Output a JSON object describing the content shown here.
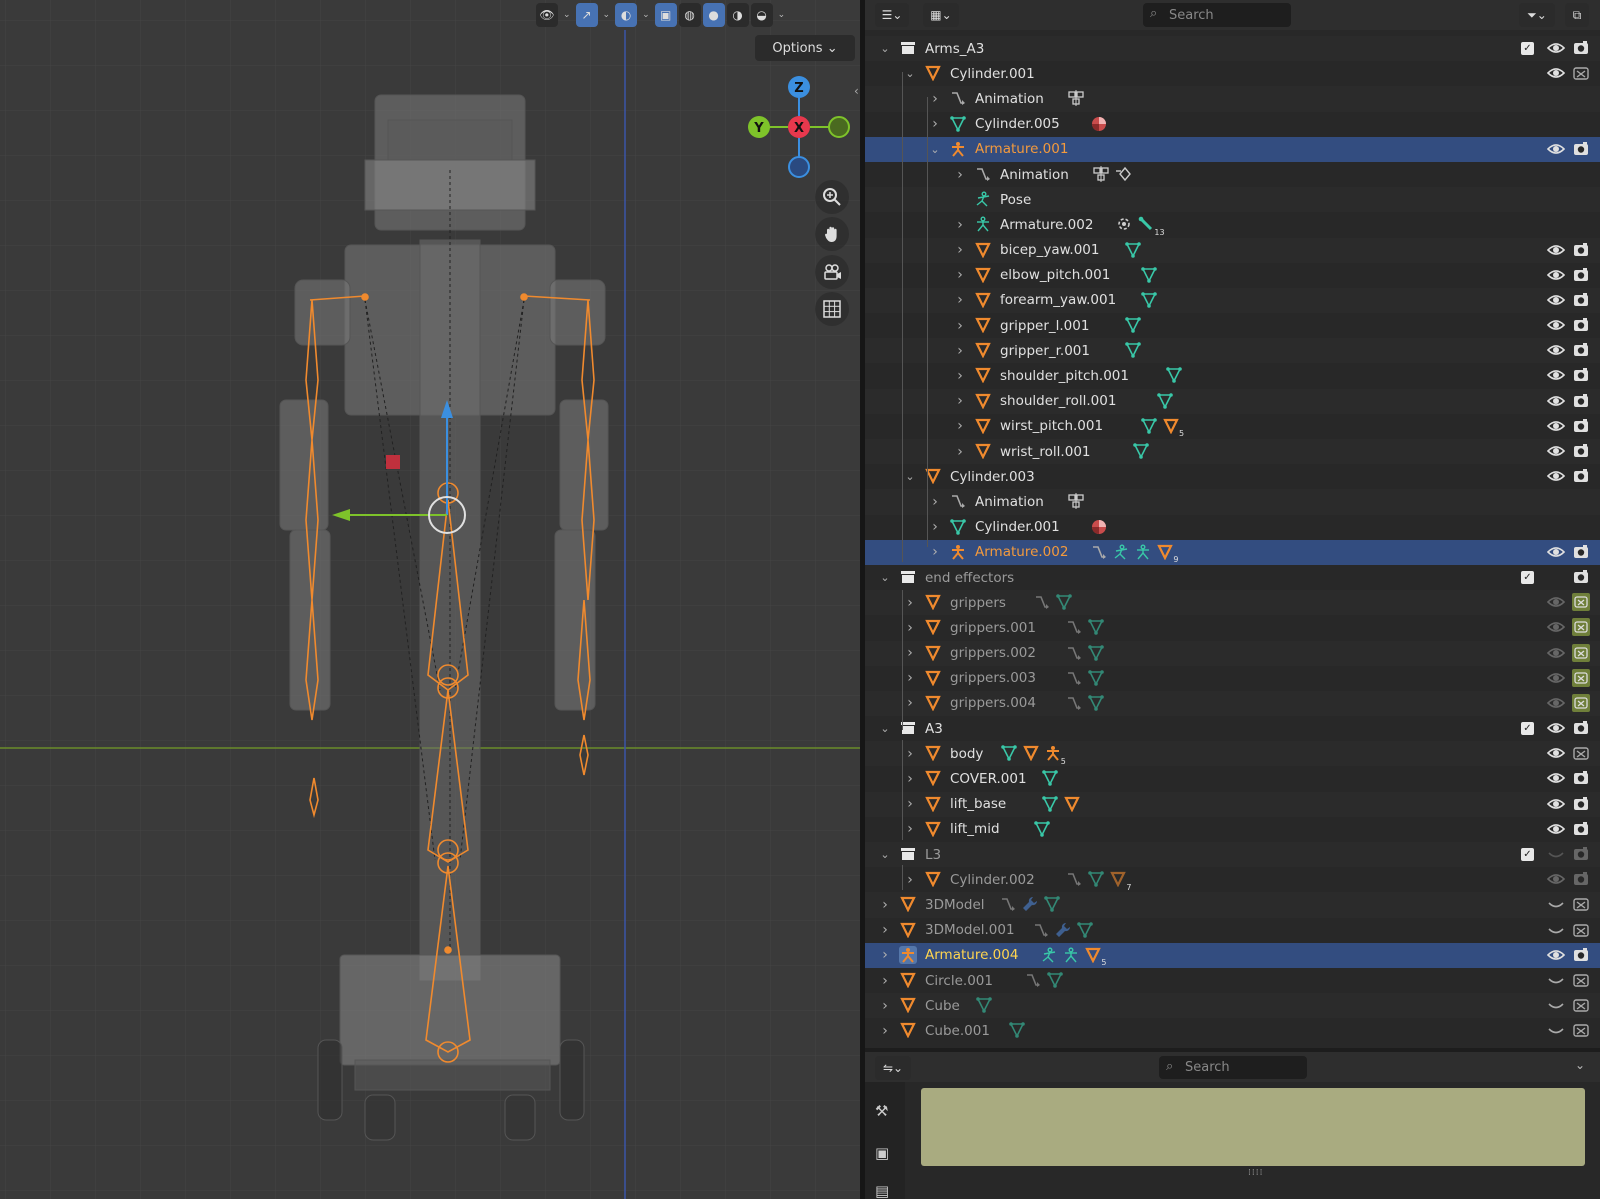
{
  "viewport": {
    "options_label": "Options",
    "gizmo": {
      "z": "Z",
      "y": "Y",
      "x": "X"
    },
    "header_icons": [
      "visibility-icon",
      "gizmo-icon",
      "overlay-icon",
      "xray-icon",
      "wireframe-shading-icon",
      "solid-shading-icon",
      "material-shading-icon",
      "rendered-shading-icon"
    ],
    "nav_icons": [
      "zoom-icon",
      "hand-icon",
      "camera-icon",
      "grid-icon"
    ]
  },
  "outliner": {
    "search_placeholder": "Search",
    "rows": [
      {
        "label": "Arms_A3",
        "type": "collection",
        "depth": 1,
        "open": true,
        "check": true,
        "eye": true,
        "cam": true
      },
      {
        "label": "Cylinder.001",
        "type": "mesh",
        "depth": 2,
        "open": true,
        "eye": true,
        "cam": "off"
      },
      {
        "label": "Animation",
        "type": "anim",
        "depth": 3,
        "ext": [
          "action"
        ]
      },
      {
        "label": "Cylinder.005",
        "type": "meshdata",
        "depth": 3,
        "ext": [
          "material"
        ]
      },
      {
        "label": "Armature.001",
        "type": "armature",
        "depth": 3,
        "open": true,
        "state": "selected",
        "eye": true,
        "cam": true
      },
      {
        "label": "Animation",
        "type": "anim",
        "depth": 4,
        "ext": [
          "action",
          "drivers"
        ]
      },
      {
        "label": "Pose",
        "type": "pose",
        "depth": 4,
        "nodisc": true
      },
      {
        "label": "Armature.002",
        "type": "armaturedata",
        "depth": 4,
        "ext": [
          "bonegroup",
          "bone"
        ],
        "extcount": "13"
      },
      {
        "label": "bicep_yaw.001",
        "type": "mesh",
        "depth": 4,
        "ext": [
          "meshdata"
        ],
        "eye": true,
        "cam": true
      },
      {
        "label": "elbow_pitch.001",
        "type": "mesh",
        "depth": 4,
        "ext": [
          "meshdata"
        ],
        "eye": true,
        "cam": true
      },
      {
        "label": "forearm_yaw.001",
        "type": "mesh",
        "depth": 4,
        "ext": [
          "meshdata"
        ],
        "eye": true,
        "cam": true
      },
      {
        "label": "gripper_l.001",
        "type": "mesh",
        "depth": 4,
        "ext": [
          "meshdata"
        ],
        "eye": true,
        "cam": true
      },
      {
        "label": "gripper_r.001",
        "type": "mesh",
        "depth": 4,
        "ext": [
          "meshdata"
        ],
        "eye": true,
        "cam": true
      },
      {
        "label": "shoulder_pitch.001",
        "type": "mesh",
        "depth": 4,
        "ext": [
          "meshdata"
        ],
        "eye": true,
        "cam": true
      },
      {
        "label": "shoulder_roll.001",
        "type": "mesh",
        "depth": 4,
        "ext": [
          "meshdata"
        ],
        "eye": true,
        "cam": true
      },
      {
        "label": "wirst_pitch.001",
        "type": "mesh",
        "depth": 4,
        "ext": [
          "meshdata",
          "mesh"
        ],
        "extcount": "5",
        "eye": true,
        "cam": true
      },
      {
        "label": "wrist_roll.001",
        "type": "mesh",
        "depth": 4,
        "ext": [
          "meshdata"
        ],
        "eye": true,
        "cam": true
      },
      {
        "label": "Cylinder.003",
        "type": "mesh",
        "depth": 2,
        "open": true,
        "eye": true,
        "cam": true
      },
      {
        "label": "Animation",
        "type": "anim",
        "depth": 3,
        "ext": [
          "action"
        ]
      },
      {
        "label": "Cylinder.001",
        "type": "meshdata",
        "depth": 3,
        "ext": [
          "material"
        ]
      },
      {
        "label": "Armature.002",
        "type": "armature",
        "depth": 3,
        "state": "selected",
        "ext": [
          "anim",
          "pose",
          "armaturedata",
          "mesh"
        ],
        "extcount": "9",
        "eye": true,
        "cam": true
      },
      {
        "label": "end effectors",
        "type": "collection",
        "depth": 1,
        "open": true,
        "dim": true,
        "check": true,
        "eye": "none",
        "cam": true
      },
      {
        "label": "grippers",
        "type": "mesh",
        "depth": 2,
        "dim": true,
        "ext": [
          "anim",
          "meshdata"
        ],
        "eye": "dim",
        "cam": "green"
      },
      {
        "label": "grippers.001",
        "type": "mesh",
        "depth": 2,
        "dim": true,
        "ext": [
          "anim",
          "meshdata"
        ],
        "eye": "dim",
        "cam": "green"
      },
      {
        "label": "grippers.002",
        "type": "mesh",
        "depth": 2,
        "dim": true,
        "ext": [
          "anim",
          "meshdata"
        ],
        "eye": "dim",
        "cam": "green"
      },
      {
        "label": "grippers.003",
        "type": "mesh",
        "depth": 2,
        "dim": true,
        "ext": [
          "anim",
          "meshdata"
        ],
        "eye": "dim",
        "cam": "green"
      },
      {
        "label": "grippers.004",
        "type": "mesh",
        "depth": 2,
        "dim": true,
        "ext": [
          "anim",
          "meshdata"
        ],
        "eye": "dim",
        "cam": "green"
      },
      {
        "label": "A3",
        "type": "collection",
        "depth": 1,
        "open": true,
        "check": true,
        "eye": true,
        "cam": true
      },
      {
        "label": "body",
        "type": "mesh",
        "depth": 2,
        "ext": [
          "meshdata",
          "mesh",
          "armature"
        ],
        "extcount": "5",
        "eye": true,
        "cam": "off"
      },
      {
        "label": "COVER.001",
        "type": "mesh",
        "depth": 2,
        "ext": [
          "meshdata"
        ],
        "eye": true,
        "cam": true
      },
      {
        "label": "lift_base",
        "type": "mesh",
        "depth": 2,
        "ext": [
          "meshdata",
          "mesh"
        ],
        "eye": true,
        "cam": true
      },
      {
        "label": "lift_mid",
        "type": "mesh",
        "depth": 2,
        "ext": [
          "meshdata"
        ],
        "eye": true,
        "cam": true
      },
      {
        "label": "L3",
        "type": "collection",
        "depth": 1,
        "open": true,
        "dim": true,
        "check": true,
        "eye": "closed-dim",
        "cam": "dim"
      },
      {
        "label": "Cylinder.002",
        "type": "mesh",
        "depth": 2,
        "dim": true,
        "ext": [
          "anim",
          "meshdata",
          "mesh"
        ],
        "extcount": "7",
        "eye": "dim",
        "cam": "dim"
      },
      {
        "label": "3DModel",
        "type": "mesh",
        "depth": 1,
        "dim": true,
        "ext": [
          "anim",
          "wrench",
          "meshdata"
        ],
        "eye": "closed",
        "cam": "off"
      },
      {
        "label": "3DModel.001",
        "type": "mesh",
        "depth": 1,
        "dim": true,
        "ext": [
          "anim",
          "wrench",
          "meshdata"
        ],
        "eye": "closed",
        "cam": "off"
      },
      {
        "label": "Armature.004",
        "type": "armature",
        "depth": 1,
        "state": "active",
        "ext": [
          "pose",
          "armaturedata",
          "mesh"
        ],
        "extcount": "5",
        "eye": true,
        "cam": true
      },
      {
        "label": "Circle.001",
        "type": "mesh",
        "depth": 1,
        "dim": true,
        "ext": [
          "anim",
          "meshdata"
        ],
        "eye": "closed",
        "cam": "off"
      },
      {
        "label": "Cube",
        "type": "mesh",
        "depth": 1,
        "dim": true,
        "ext": [
          "meshdata"
        ],
        "eye": "closed",
        "cam": "off"
      },
      {
        "label": "Cube.001",
        "type": "mesh",
        "depth": 1,
        "dim": true,
        "ext": [
          "meshdata"
        ],
        "eye": "closed",
        "cam": "off"
      }
    ]
  },
  "properties": {
    "search_placeholder": "Search",
    "panel_color": "#a9ab80",
    "tabs": [
      "tool-icon",
      "render-icon",
      "output-icon"
    ]
  },
  "colors": {
    "bone_orange": "#f08a2e",
    "selected_row": "#334d80",
    "axis_x": "#e8384d",
    "axis_y": "#7ec32a",
    "axis_z": "#3b8fe0"
  }
}
